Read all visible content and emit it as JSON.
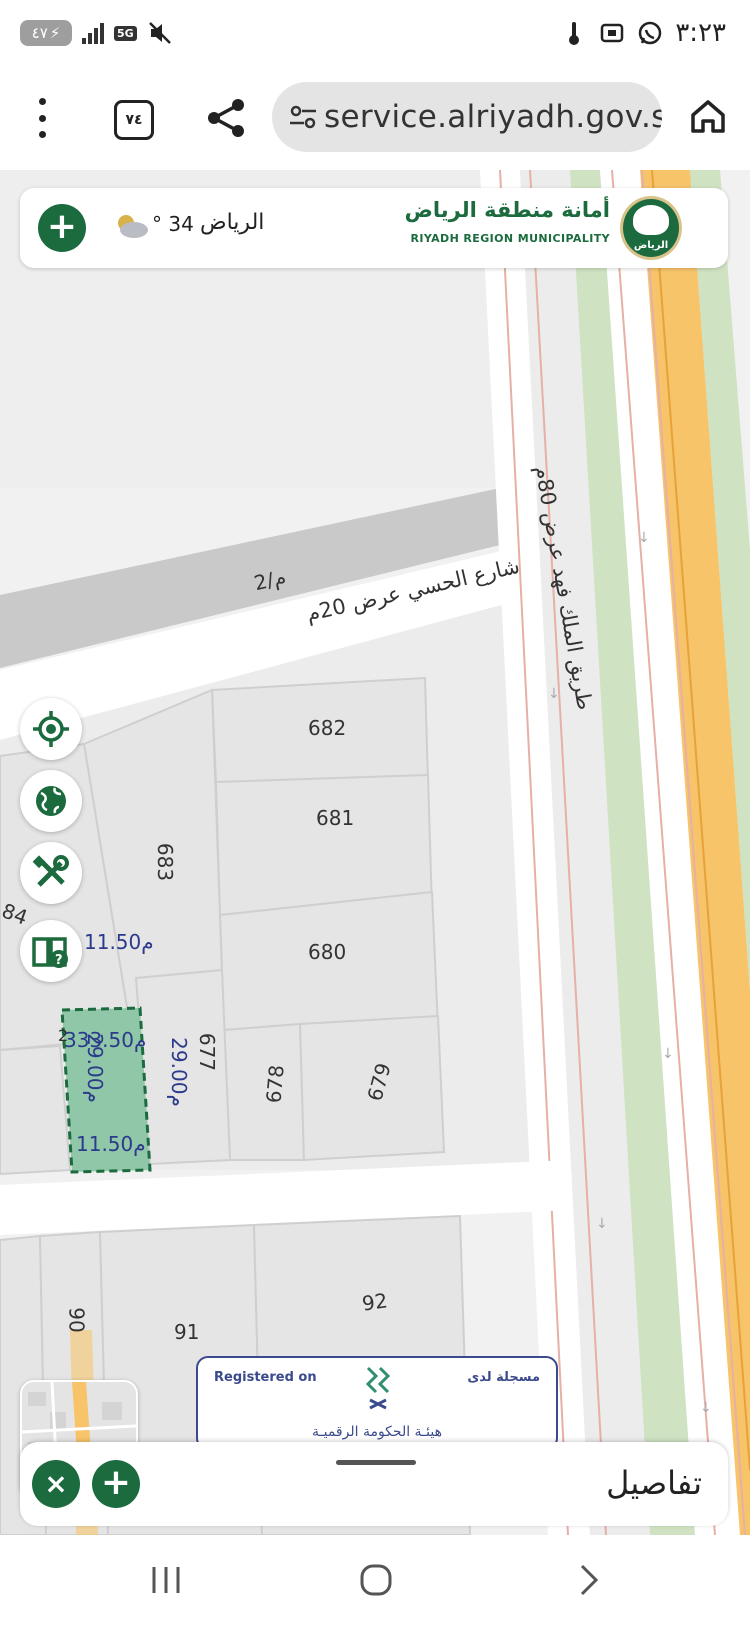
{
  "status_bar": {
    "time": "٣:٢٣",
    "battery": "٤٧",
    "network": "5G",
    "icons": [
      "battery-icon",
      "signal-icon",
      "mute-icon",
      "thermometer-icon",
      "screen-record-icon",
      "whatsapp-icon"
    ]
  },
  "browser": {
    "url": "service.alriyadh.gov.sa",
    "tab_count": "٧٤",
    "icons": [
      "menu-icon",
      "tabs-icon",
      "share-icon",
      "site-settings-icon",
      "home-icon"
    ]
  },
  "header": {
    "add_label": "+",
    "temperature": "34 °",
    "city": "الرياض",
    "org_name_ar": "أمانة منطقة الرياض",
    "org_name_en": "RIYADH REGION MUNICIPALITY",
    "logo_text": "الرياض"
  },
  "map": {
    "parcels": [
      "682",
      "681",
      "680",
      "683",
      "679",
      "678",
      "677",
      "92",
      "91",
      "90"
    ],
    "road_label_fahd": "طريق الملك فهد عرض 80م",
    "road_label_street": "شارع الحسي عرض 20م",
    "road_label_2m": "2/م",
    "selected_dimensions": {
      "top": "11.50م",
      "area": "333.50م",
      "left": "29.00م",
      "right": "29.00م",
      "bottom": "11.50م"
    },
    "partial_labels": [
      "84",
      "2"
    ],
    "tools": [
      "locate-icon",
      "globe-icon",
      "tools-icon",
      "guide-book-icon"
    ]
  },
  "registration": {
    "en": "Registered on",
    "ar": "مسجلة لدى",
    "authority": "هيئـة الحكومة الرقميـة"
  },
  "bottom_sheet": {
    "title": "تفاصيل",
    "close_label": "×",
    "add_label": "+"
  },
  "colors": {
    "brand_green": "#1b6b3e",
    "highway_orange": "#f7c46a",
    "selected_parcel": "#8fc7a8",
    "dimension_text": "#2b3a8a"
  }
}
